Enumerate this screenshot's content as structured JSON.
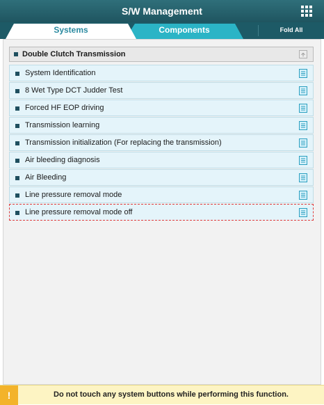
{
  "header": {
    "title": "S/W Management",
    "menu_icon": "grid-icon"
  },
  "tabs": {
    "items": [
      "Systems",
      "Components"
    ],
    "active": "Systems",
    "fold_all_label": "Fold All"
  },
  "group": {
    "title": "Double Clutch Transmission",
    "collapse_icon": "collapse-up-icon"
  },
  "functions": [
    "System Identification",
    "8 Wet Type DCT Judder Test",
    "Forced HF EOP driving",
    "Transmission learning",
    "Transmission initialization (For replacing the transmission)",
    "Air bleeding diagnosis",
    "Air Bleeding",
    "Line pressure removal mode",
    "Line pressure removal mode off"
  ],
  "selected_function": "Line pressure removal mode off",
  "row_icon": "document-icon",
  "footer": {
    "warning_icon": "!",
    "message": "Do not touch any system buttons while performing this function."
  },
  "colors": {
    "header": "#1f5560",
    "tab_strip": "#1d5a66",
    "active_tab": "#ffffff",
    "inactive_tab": "#2bb4c6",
    "row_background": "#e4f4fa",
    "selected_border": "#e03c3c",
    "warning": "#f3b32a",
    "footer_background": "#fdf4c3"
  }
}
